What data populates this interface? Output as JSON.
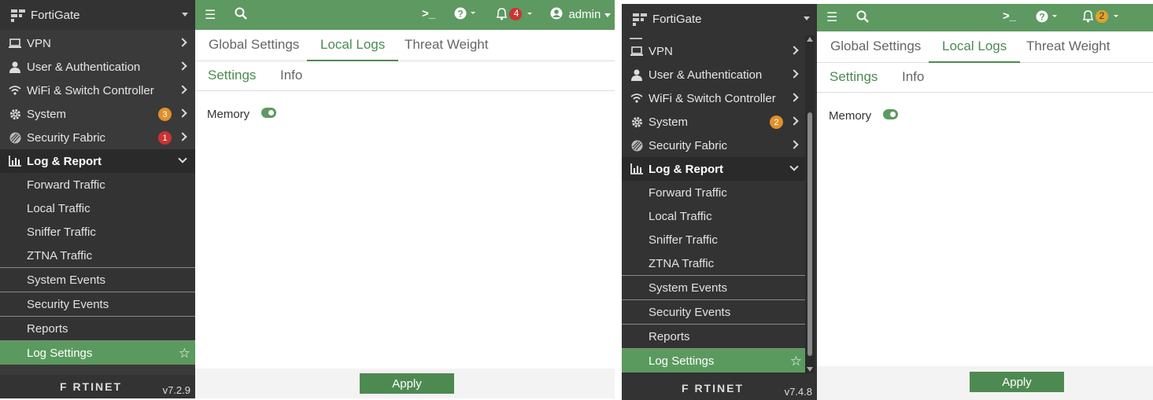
{
  "left": {
    "app_name": "FortiGate",
    "menu": [
      {
        "label": "VPN",
        "icon": "laptop-icon"
      },
      {
        "label": "User & Authentication",
        "icon": "user-icon"
      },
      {
        "label": "WiFi & Switch Controller",
        "icon": "wifi-icon"
      },
      {
        "label": "System",
        "icon": "gear-icon",
        "badge": "3"
      },
      {
        "label": "Security Fabric",
        "icon": "fabric-icon",
        "badge": "1"
      },
      {
        "label": "Log & Report",
        "icon": "chart-icon"
      }
    ],
    "sub": [
      "Forward Traffic",
      "Local Traffic",
      "Sniffer Traffic",
      "ZTNA Traffic",
      "System Events",
      "Security Events",
      "Reports",
      "Log Settings"
    ],
    "brand": "F RTINET",
    "version": "v7.2.9",
    "notif_count": "4",
    "user": "admin"
  },
  "right": {
    "app_name": "FortiGate",
    "menu": [
      {
        "label": "VPN",
        "icon": "laptop-icon"
      },
      {
        "label": "User & Authentication",
        "icon": "user-icon"
      },
      {
        "label": "WiFi & Switch Controller",
        "icon": "wifi-icon"
      },
      {
        "label": "System",
        "icon": "gear-icon",
        "badge": "2"
      },
      {
        "label": "Security Fabric",
        "icon": "fabric-icon"
      },
      {
        "label": "Log & Report",
        "icon": "chart-icon"
      }
    ],
    "sub": [
      "Forward Traffic",
      "Local Traffic",
      "Sniffer Traffic",
      "ZTNA Traffic",
      "System Events",
      "Security Events",
      "Reports",
      "Log Settings"
    ],
    "brand": "F RTINET",
    "version": "v7.4.8",
    "notif_count": "2"
  },
  "tabs": [
    "Global Settings",
    "Local Logs",
    "Threat Weight"
  ],
  "subtabs": [
    "Settings",
    "Info"
  ],
  "memory_label": "Memory",
  "memory_enabled": true,
  "apply_label": "Apply",
  "colors": {
    "accent": "#5d9960",
    "sidebar": "#3a3a3a",
    "badge_orange": "#e0902a",
    "badge_red": "#cc3333"
  }
}
